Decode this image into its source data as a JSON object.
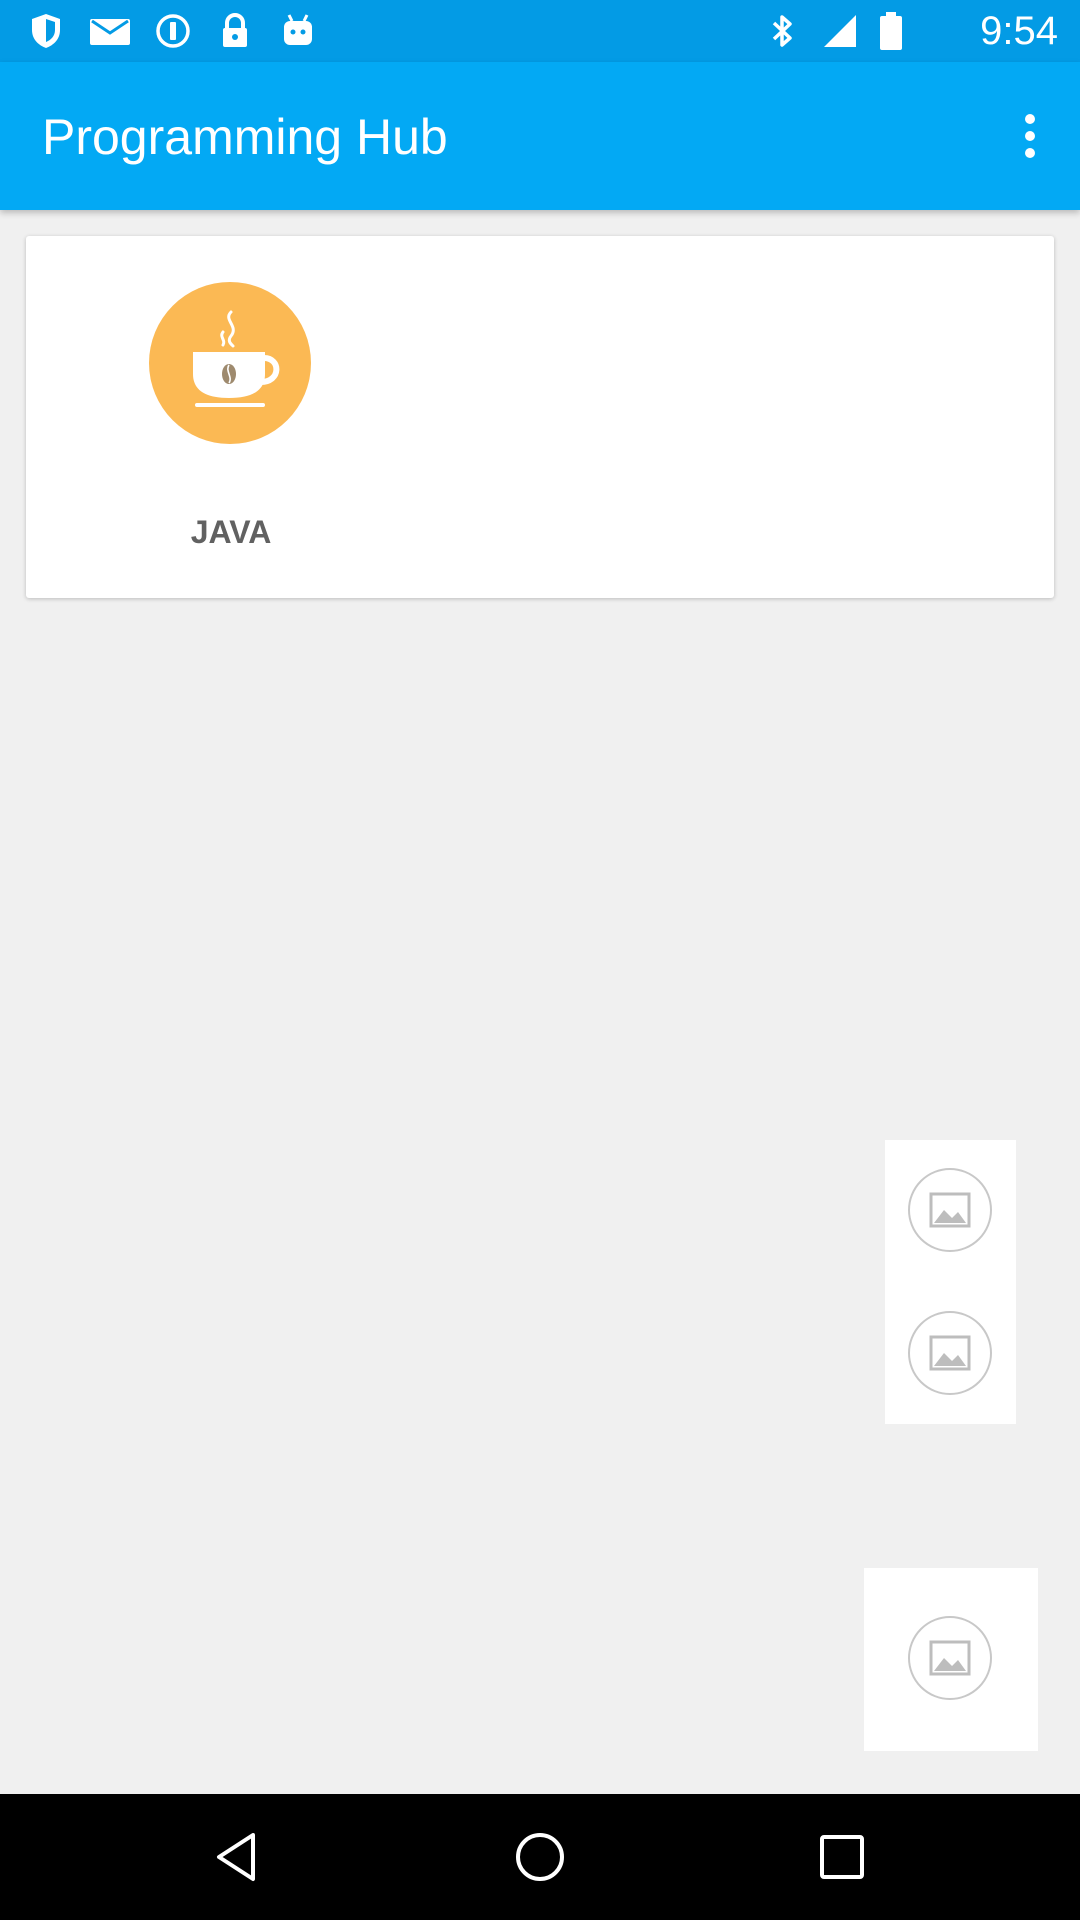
{
  "status_bar": {
    "time": "9:54",
    "left_icons": [
      "shield-icon",
      "mail-icon",
      "info-icon",
      "lock-icon",
      "android-icon"
    ],
    "right_icons": [
      "bluetooth-icon",
      "signal-icon",
      "battery-icon"
    ]
  },
  "app_bar": {
    "title": "Programming Hub",
    "overflow_icon": "more-vert-icon",
    "background": "#03a9f4"
  },
  "courses": [
    {
      "label": "JAVA",
      "icon": "coffee-cup-icon",
      "color": "#fbb954"
    }
  ],
  "placeholders": [
    "image-placeholder-icon",
    "image-placeholder-icon",
    "image-placeholder-icon"
  ],
  "nav_bar": {
    "buttons": [
      "back-icon",
      "home-icon",
      "recents-icon"
    ]
  }
}
